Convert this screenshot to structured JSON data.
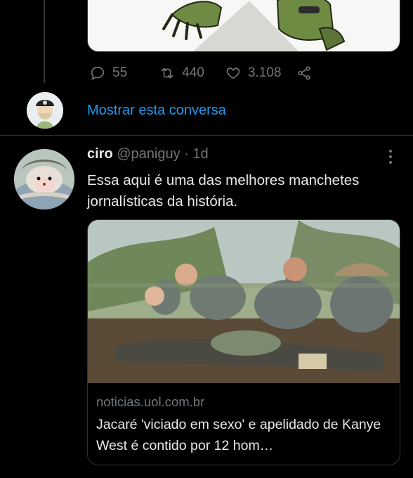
{
  "previous_tweet": {
    "stats": {
      "replies": "55",
      "retweets": "440",
      "likes": "3.108"
    },
    "show_thread_label": "Mostrar esta conversa"
  },
  "tweet": {
    "author": {
      "name": "ciro",
      "handle": "@paniguy",
      "time": "1d"
    },
    "separator": "·",
    "text": "Essa aqui é uma das melhores manchetes jornalísticas da história.",
    "link_card": {
      "domain": "noticias.uol.com.br",
      "title": "Jacaré 'viciado em sexo' e apelidado de Kanye West é contido por 12 hom…"
    }
  },
  "colors": {
    "background": "#000000",
    "link": "#1d9bf0",
    "secondary_text": "#71767b",
    "border": "#2f3336"
  },
  "icons": [
    "reply-icon",
    "retweet-icon",
    "like-icon",
    "share-icon",
    "more-icon"
  ]
}
